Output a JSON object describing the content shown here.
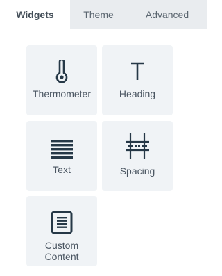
{
  "tabs": [
    {
      "label": "Widgets",
      "active": true
    },
    {
      "label": "Theme",
      "active": false
    },
    {
      "label": "Advanced",
      "active": false
    }
  ],
  "widgets": [
    {
      "label": "Thermometer",
      "icon": "thermometer-icon"
    },
    {
      "label": "Heading",
      "icon": "heading-icon"
    },
    {
      "label": "Text",
      "icon": "text-lines-icon"
    },
    {
      "label": "Spacing",
      "icon": "spacing-icon"
    },
    {
      "label": "Custom\nContent",
      "icon": "custom-content-icon"
    }
  ],
  "colors": {
    "icon": "#263847",
    "label": "#4a5561",
    "tile_bg": "#f0f3f6",
    "tab_bar_bg": "#e9ecef"
  }
}
